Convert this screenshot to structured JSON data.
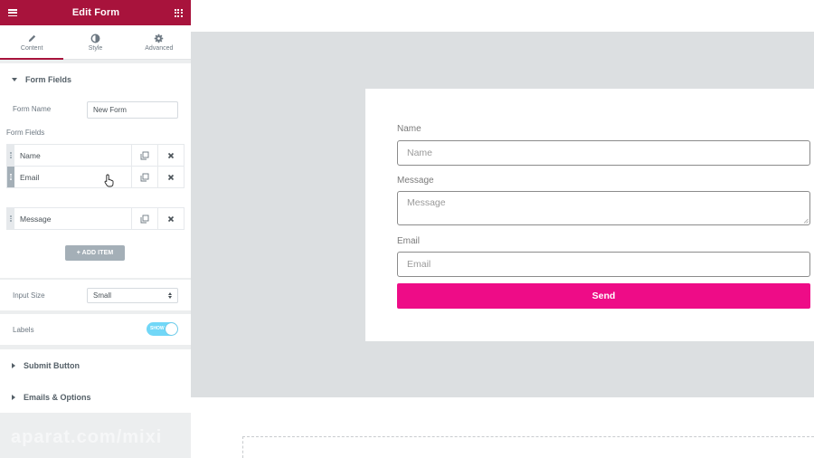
{
  "header": {
    "title": "Edit Form"
  },
  "tabs": [
    {
      "label": "Content",
      "icon": "pencil-icon",
      "active": true
    },
    {
      "label": "Style",
      "icon": "contrast-icon",
      "active": false
    },
    {
      "label": "Advanced",
      "icon": "gear-icon",
      "active": false
    }
  ],
  "form_fields_section": {
    "title": "Form Fields",
    "form_name_label": "Form Name",
    "form_name_value": "New Form",
    "fields_label": "Form Fields",
    "items": [
      {
        "label": "Name"
      },
      {
        "label": "Email"
      },
      {
        "label": "Message"
      }
    ],
    "add_item_label": "+ ADD ITEM"
  },
  "input_size": {
    "label": "Input Size",
    "value": "Small"
  },
  "labels_toggle": {
    "label": "Labels",
    "state_text": "SHOW",
    "on": true
  },
  "collapsed_sections": [
    {
      "title": "Submit Button"
    },
    {
      "title": "Emails & Options"
    }
  ],
  "watermark": "aparat.com/mixi",
  "preview_form": {
    "name_label": "Name",
    "name_placeholder": "Name",
    "message_label": "Message",
    "message_placeholder": "Message",
    "email_label": "Email",
    "email_placeholder": "Email",
    "submit_label": "Send"
  },
  "colors": {
    "header_bg": "#a8133c",
    "submit_bg": "#ee0c87",
    "toggle_on": "#71d7f7",
    "preview_bg": "#dcdfe1"
  }
}
